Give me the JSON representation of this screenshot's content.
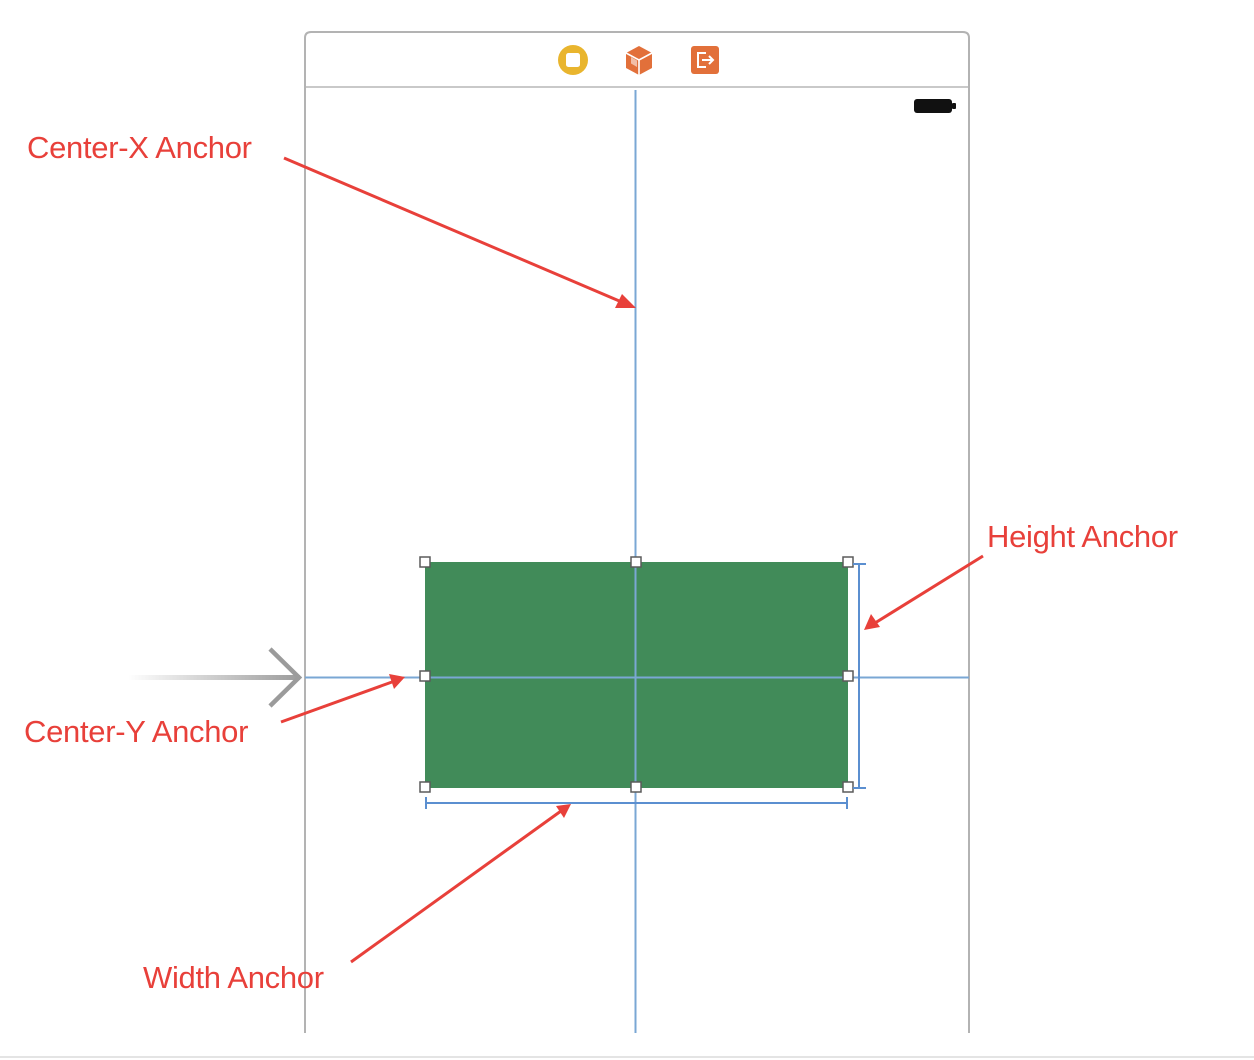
{
  "scene": {
    "toolbar_icons": [
      {
        "icon": "view-controller-icon",
        "color": "#e9b52e"
      },
      {
        "icon": "first-responder-cube-icon",
        "color": "#e2703a"
      },
      {
        "icon": "exit-icon",
        "color": "#e2703a"
      }
    ],
    "status_bar": {
      "icon": "battery-icon"
    },
    "entry_point": {
      "icon": "entry-point-arrow-icon",
      "color": "#9b9b9b"
    },
    "view_color": "#418b59",
    "guide_color": "#7aa7d4",
    "constraint_color": "#5b8fd0"
  },
  "annotations": {
    "color": "#e8403a",
    "center_x": "Center-X Anchor",
    "height": "Height Anchor",
    "center_y": "Center-Y Anchor",
    "width": "Width Anchor"
  }
}
